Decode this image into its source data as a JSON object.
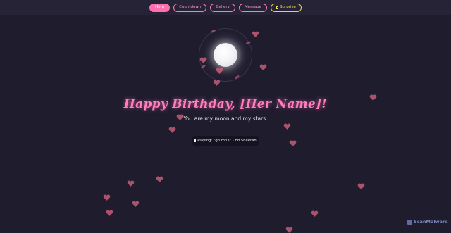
{
  "nav": {
    "items": [
      {
        "label": "Hero",
        "active": true
      },
      {
        "label": "Countdown",
        "active": false
      },
      {
        "label": "Gallery",
        "active": false
      },
      {
        "label": "Message",
        "active": false
      },
      {
        "label": "Surprise",
        "active": false
      }
    ]
  },
  "hero": {
    "title": "Happy Birthday, [Her Name]!",
    "subtitle": "You are my moon and my stars.",
    "now_playing": "Playing: \"gh.mp3\" - Ed Sheeran"
  },
  "watermark": "ScanMalware",
  "colors": {
    "background": "#1f1c2e",
    "accent_pink": "#ff6fae",
    "surprise_yellow": "#e9d34a",
    "heart": "#d9667f"
  },
  "icons": [
    "moon-icon",
    "heart-icon",
    "music-note-icon",
    "gift-icon"
  ]
}
